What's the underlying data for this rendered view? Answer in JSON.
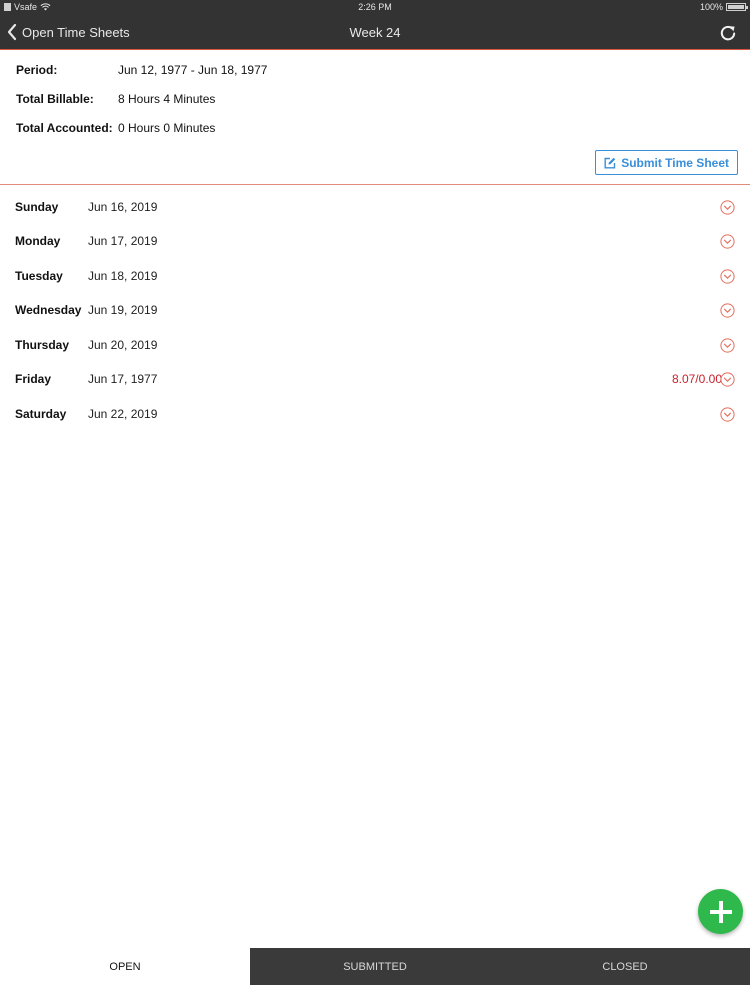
{
  "status_bar": {
    "carrier": "Vsafe",
    "time": "2:26 PM",
    "battery": "100%"
  },
  "nav": {
    "back_label": "Open Time Sheets",
    "title": "Week 24",
    "back_icon": "chevron-left-icon",
    "refresh_icon": "refresh-icon"
  },
  "summary": {
    "period_label": "Period:",
    "period_value": "Jun 12, 1977 - Jun 18, 1977",
    "billable_label": "Total Billable:",
    "billable_value": "8 Hours 4 Minutes",
    "accounted_label": "Total Accounted:",
    "accounted_value": "0 Hours 0 Minutes",
    "submit_label": "Submit Time Sheet"
  },
  "days": [
    {
      "name": "Sunday",
      "date": "Jun 16, 2019",
      "hours": ""
    },
    {
      "name": "Monday",
      "date": "Jun 17, 2019",
      "hours": ""
    },
    {
      "name": "Tuesday",
      "date": "Jun 18, 2019",
      "hours": ""
    },
    {
      "name": "Wednesday",
      "date": "Jun 19, 2019",
      "hours": ""
    },
    {
      "name": "Thursday",
      "date": "Jun 20, 2019",
      "hours": ""
    },
    {
      "name": "Friday",
      "date": "Jun 17, 1977",
      "hours": "8.07/0.00"
    },
    {
      "name": "Saturday",
      "date": "Jun 22, 2019",
      "hours": ""
    }
  ],
  "tabs": [
    {
      "label": "OPEN",
      "active": true
    },
    {
      "label": "SUBMITTED",
      "active": false
    },
    {
      "label": "CLOSED",
      "active": false
    }
  ],
  "colors": {
    "header_bg": "#333333",
    "accent_line": "#d9553f",
    "submit_blue": "#3a8fd8",
    "hours_red": "#c8202d",
    "fab_green": "#2fb84b",
    "expand_icon": "#e0705f"
  }
}
